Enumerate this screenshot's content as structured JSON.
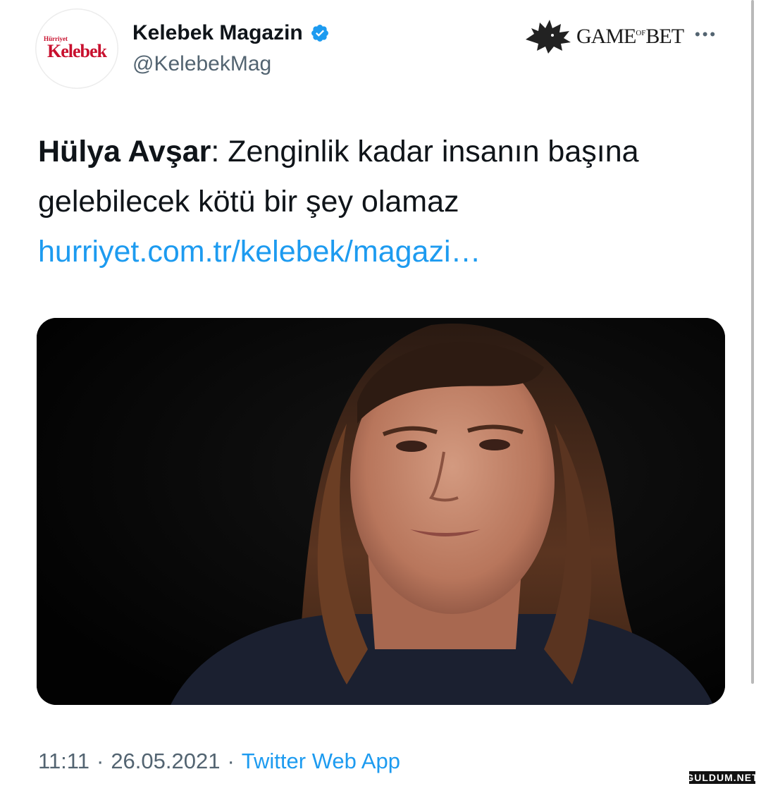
{
  "tweet": {
    "author": {
      "display_name": "Kelebek Magazin",
      "handle": "@KelebekMag",
      "verified": true,
      "avatar_small_text": "Hürriyet",
      "avatar_big_text": "Kelebek"
    },
    "text_bold": "Hülya Avşar",
    "text_rest": ": Zenginlik kadar insanın başına gelebilecek kötü bir şey olamaz",
    "link": "hurriyet.com.tr/kelebek/magazi…",
    "time": "11:11",
    "date": "26.05.2021",
    "source": "Twitter Web App"
  },
  "watermark": {
    "text_a": "GAME",
    "text_sup": "OF",
    "text_b": "BET",
    "icon": "wolf-icon"
  },
  "site_badge": "GULDUM.NET",
  "icons": {
    "verified": "verified-badge-icon",
    "more": "more-options-icon"
  },
  "colors": {
    "link": "#1d9bf0",
    "secondary_text": "#536471",
    "brand_red": "#c8102e"
  }
}
